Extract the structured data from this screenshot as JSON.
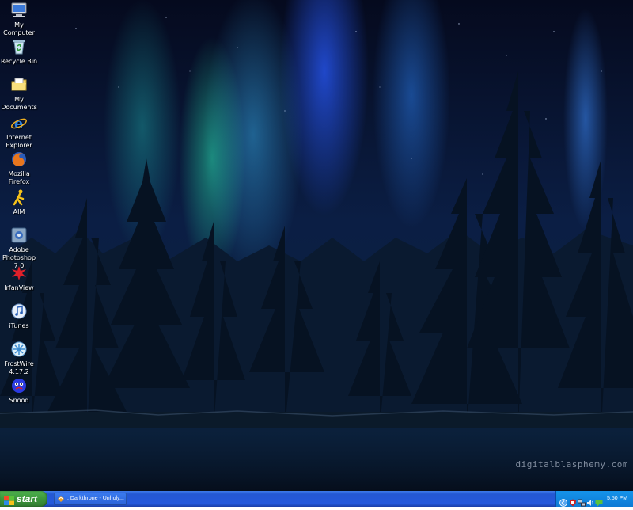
{
  "desktop": {
    "wallpaper_watermark": "digitalblasphemy.com",
    "icons": [
      {
        "label": "My Computer",
        "icon": "computer-icon"
      },
      {
        "label": "Recycle Bin",
        "icon": "recycle-bin-icon"
      },
      {
        "label": "My Documents",
        "icon": "folder-icon"
      },
      {
        "label": "Internet Explorer",
        "icon": "internet-explorer-icon"
      },
      {
        "label": "Mozilla Firefox",
        "icon": "firefox-icon"
      },
      {
        "label": "AIM",
        "icon": "aim-icon"
      },
      {
        "label": "Adobe Photoshop 7.0",
        "icon": "photoshop-icon"
      },
      {
        "label": "IrfanView",
        "icon": "irfanview-icon"
      },
      {
        "label": "iTunes",
        "icon": "itunes-icon"
      },
      {
        "label": "FrostWire 4.17.2",
        "icon": "frostwire-icon"
      },
      {
        "label": "Snood",
        "icon": "snood-icon"
      }
    ]
  },
  "taskbar": {
    "start_label": "start",
    "items": [
      {
        "label": ". Darkthrone - Unholy..."
      }
    ],
    "tray": {
      "clock": "5:50 PM",
      "icons": [
        "arrow-left-icon",
        "shield-icon",
        "network-icon",
        "volume-icon",
        "chat-icon",
        "monitor-icon"
      ]
    }
  },
  "colors": {
    "taskbar_blue": "#2459dc",
    "start_green": "#3c963c",
    "tray_blue": "#0d7bd5"
  }
}
